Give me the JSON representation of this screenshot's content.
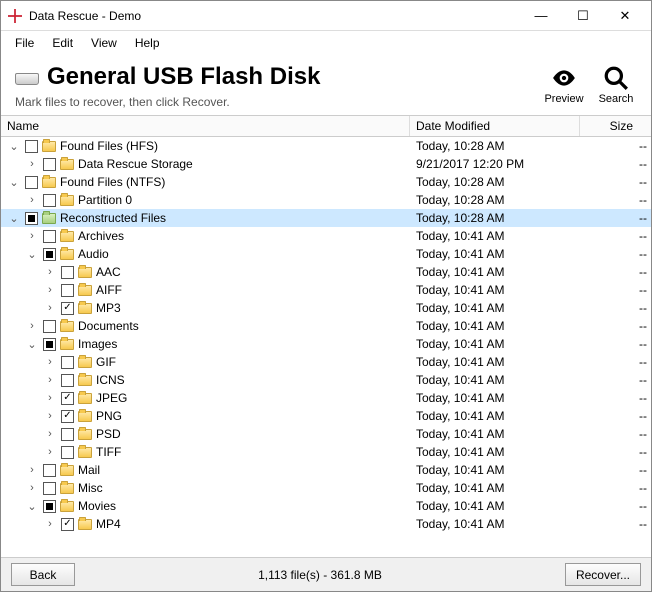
{
  "window": {
    "title": "Data Rescue - Demo"
  },
  "menubar": {
    "items": [
      "File",
      "Edit",
      "View",
      "Help"
    ]
  },
  "header": {
    "title": "General USB Flash Disk",
    "subtitle": "Mark files to recover, then click Recover.",
    "actions": {
      "preview": "Preview",
      "search": "Search"
    }
  },
  "columns": {
    "name": "Name",
    "date": "Date Modified",
    "size": "Size"
  },
  "rows": [
    {
      "indent": 0,
      "arrow": "down",
      "check": "empty",
      "folder": "normal",
      "label": "Found Files (HFS)",
      "date": "Today, 10:28 AM",
      "size": "--"
    },
    {
      "indent": 1,
      "arrow": "right",
      "check": "empty",
      "folder": "normal",
      "label": "Data Rescue Storage",
      "date": "9/21/2017 12:20 PM",
      "size": "--"
    },
    {
      "indent": 0,
      "arrow": "down",
      "check": "empty",
      "folder": "normal",
      "label": "Found Files (NTFS)",
      "date": "Today, 10:28 AM",
      "size": "--"
    },
    {
      "indent": 1,
      "arrow": "right",
      "check": "empty",
      "folder": "normal",
      "label": "Partition 0",
      "date": "Today, 10:28 AM",
      "size": "--"
    },
    {
      "indent": 0,
      "arrow": "down",
      "check": "mixed",
      "folder": "hl",
      "label": "Reconstructed Files",
      "date": "Today, 10:28 AM",
      "size": "--",
      "selected": true
    },
    {
      "indent": 1,
      "arrow": "right",
      "check": "empty",
      "folder": "normal",
      "label": "Archives",
      "date": "Today, 10:41 AM",
      "size": "--"
    },
    {
      "indent": 1,
      "arrow": "down",
      "check": "mixed",
      "folder": "normal",
      "label": "Audio",
      "date": "Today, 10:41 AM",
      "size": "--"
    },
    {
      "indent": 2,
      "arrow": "right",
      "check": "empty",
      "folder": "normal",
      "label": "AAC",
      "date": "Today, 10:41 AM",
      "size": "--"
    },
    {
      "indent": 2,
      "arrow": "right",
      "check": "empty",
      "folder": "normal",
      "label": "AIFF",
      "date": "Today, 10:41 AM",
      "size": "--"
    },
    {
      "indent": 2,
      "arrow": "right",
      "check": "checked",
      "folder": "normal",
      "label": "MP3",
      "date": "Today, 10:41 AM",
      "size": "--"
    },
    {
      "indent": 1,
      "arrow": "right",
      "check": "empty",
      "folder": "normal",
      "label": "Documents",
      "date": "Today, 10:41 AM",
      "size": "--"
    },
    {
      "indent": 1,
      "arrow": "down",
      "check": "mixed",
      "folder": "normal",
      "label": "Images",
      "date": "Today, 10:41 AM",
      "size": "--"
    },
    {
      "indent": 2,
      "arrow": "right",
      "check": "empty",
      "folder": "normal",
      "label": "GIF",
      "date": "Today, 10:41 AM",
      "size": "--"
    },
    {
      "indent": 2,
      "arrow": "right",
      "check": "empty",
      "folder": "normal",
      "label": "ICNS",
      "date": "Today, 10:41 AM",
      "size": "--"
    },
    {
      "indent": 2,
      "arrow": "right",
      "check": "checked",
      "folder": "normal",
      "label": "JPEG",
      "date": "Today, 10:41 AM",
      "size": "--"
    },
    {
      "indent": 2,
      "arrow": "right",
      "check": "checked",
      "folder": "normal",
      "label": "PNG",
      "date": "Today, 10:41 AM",
      "size": "--"
    },
    {
      "indent": 2,
      "arrow": "right",
      "check": "empty",
      "folder": "normal",
      "label": "PSD",
      "date": "Today, 10:41 AM",
      "size": "--"
    },
    {
      "indent": 2,
      "arrow": "right",
      "check": "empty",
      "folder": "normal",
      "label": "TIFF",
      "date": "Today, 10:41 AM",
      "size": "--"
    },
    {
      "indent": 1,
      "arrow": "right",
      "check": "empty",
      "folder": "normal",
      "label": "Mail",
      "date": "Today, 10:41 AM",
      "size": "--"
    },
    {
      "indent": 1,
      "arrow": "right",
      "check": "empty",
      "folder": "normal",
      "label": "Misc",
      "date": "Today, 10:41 AM",
      "size": "--"
    },
    {
      "indent": 1,
      "arrow": "down",
      "check": "mixed",
      "folder": "normal",
      "label": "Movies",
      "date": "Today, 10:41 AM",
      "size": "--"
    },
    {
      "indent": 2,
      "arrow": "right",
      "check": "checked",
      "folder": "normal",
      "label": "MP4",
      "date": "Today, 10:41 AM",
      "size": "--"
    }
  ],
  "footer": {
    "back": "Back",
    "status": "1,113 file(s) - 361.8 MB",
    "recover": "Recover..."
  }
}
